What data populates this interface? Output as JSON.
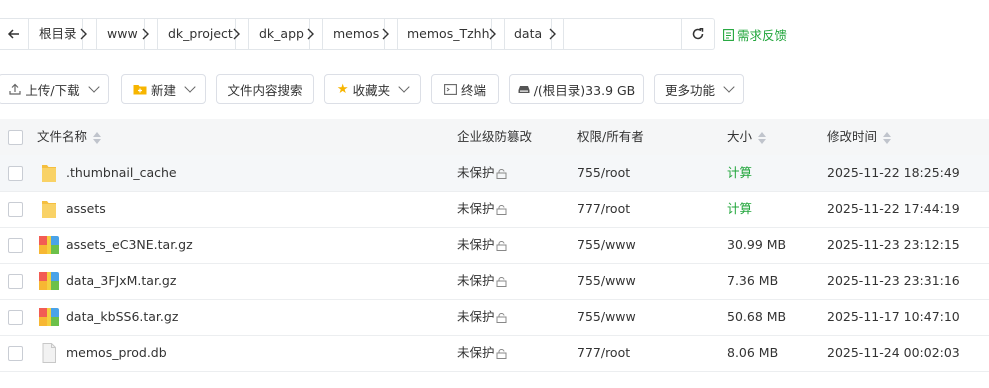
{
  "breadcrumb": {
    "items": [
      "根目录",
      "www",
      "dk_project",
      "dk_app",
      "memos",
      "memos_Tzhh",
      "data"
    ]
  },
  "feedback_label": "需求反馈",
  "toolbar": {
    "upload_label": "上传/下载",
    "new_label": "新建",
    "search_content_label": "文件内容搜索",
    "favorites_label": "收藏夹",
    "terminal_label": "终端",
    "disk_label": "/(根目录)33.9 GB",
    "more_label": "更多功能"
  },
  "table": {
    "headers": {
      "name": "文件名称",
      "protect": "企业级防篡改",
      "perm": "权限/所有者",
      "size": "大小",
      "mtime": "修改时间"
    },
    "rows": [
      {
        "name": ".thumbnail_cache",
        "type": "folder",
        "protect": "未保护",
        "perm": "755/root",
        "size": "计算",
        "mtime": "2025-11-22 18:25:49"
      },
      {
        "name": "assets",
        "type": "folder",
        "protect": "未保护",
        "perm": "777/root",
        "size": "计算",
        "mtime": "2025-11-22 17:44:19"
      },
      {
        "name": "assets_eC3NE.tar.gz",
        "type": "archive",
        "protect": "未保护",
        "perm": "755/www",
        "size": "30.99 MB",
        "mtime": "2025-11-23 23:12:15"
      },
      {
        "name": "data_3FJxM.tar.gz",
        "type": "archive",
        "protect": "未保护",
        "perm": "755/www",
        "size": "7.36 MB",
        "mtime": "2025-11-23 23:31:16"
      },
      {
        "name": "data_kbSS6.tar.gz",
        "type": "archive",
        "protect": "未保护",
        "perm": "755/www",
        "size": "50.68 MB",
        "mtime": "2025-11-17 10:47:10"
      },
      {
        "name": "memos_prod.db",
        "type": "file",
        "protect": "未保护",
        "perm": "777/root",
        "size": "8.06 MB",
        "mtime": "2025-11-24 00:02:03"
      }
    ]
  },
  "colors": {
    "accent": "#20a53a",
    "folder": "#f7c84a"
  }
}
